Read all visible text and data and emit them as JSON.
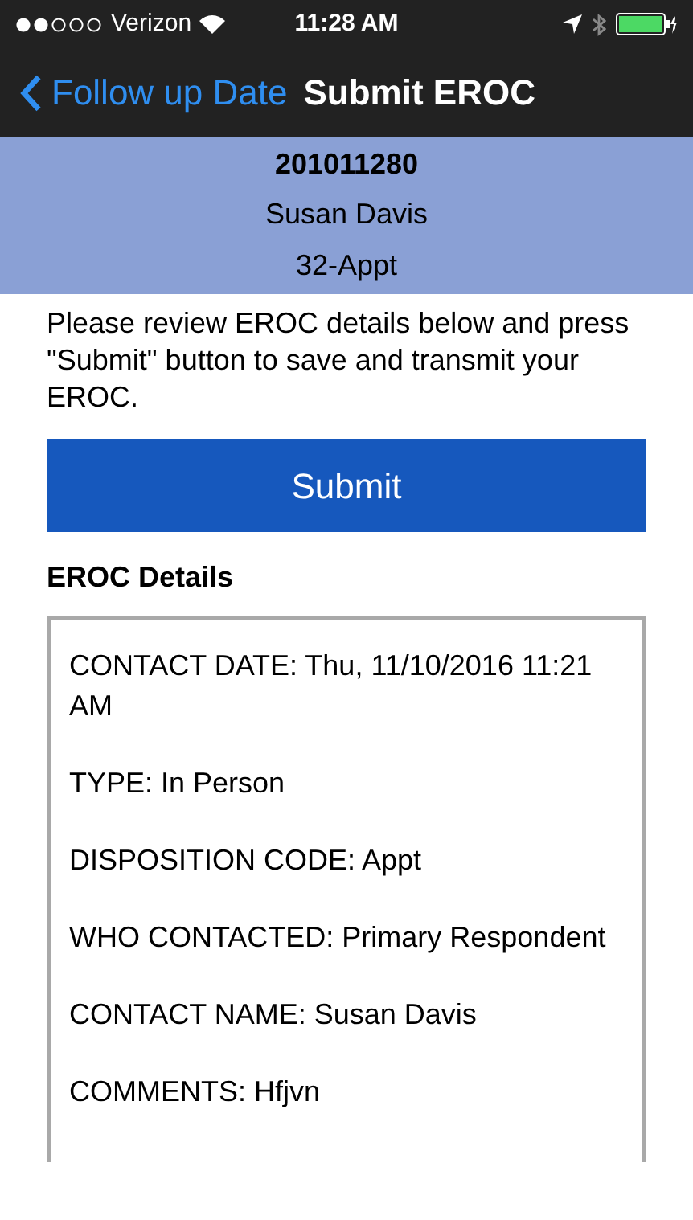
{
  "status_bar": {
    "carrier": "Verizon",
    "time": "11:28 AM"
  },
  "nav_bar": {
    "back_label": "Follow up Date",
    "title": "Submit EROC"
  },
  "header": {
    "case_id": "201011280",
    "name": "Susan Davis",
    "code": "32-Appt"
  },
  "instructions": "Please review EROC details below and press \"Submit\" button to save and transmit your EROC.",
  "submit_button": "Submit",
  "details": {
    "heading": "EROC Details",
    "lines": [
      "CONTACT DATE: Thu, 11/10/2016 11:21 AM",
      "TYPE: In Person",
      "DISPOSITION CODE: Appt",
      "WHO CONTACTED: Primary Respondent",
      "CONTACT NAME: Susan Davis",
      "COMMENTS: Hfjvn"
    ]
  }
}
